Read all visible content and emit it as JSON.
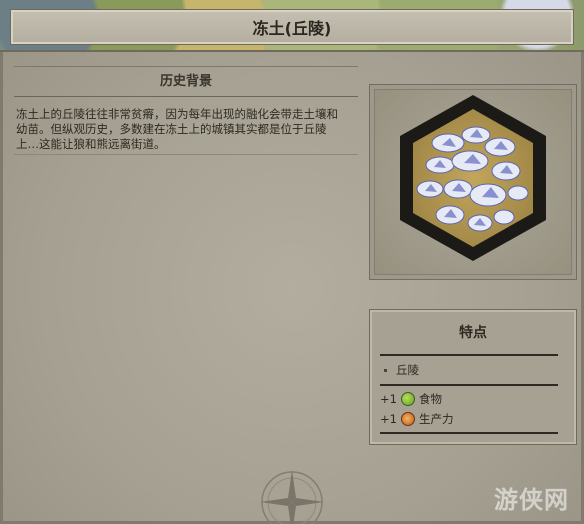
{
  "header": {
    "title": "冻土(丘陵)"
  },
  "history": {
    "title": "历史背景",
    "text": "冻土上的丘陵往往非常贫瘠，因为每年出现的融化会带走土壤和幼苗。但纵观历史，多数建在冻土上的城镇其实都是位于丘陵上…这能让狼和熊远离街道。"
  },
  "features": {
    "title": "特点",
    "terrain_item": "丘陵",
    "yields": [
      {
        "amount": "+1",
        "label": "食物",
        "icon": "food-icon"
      },
      {
        "amount": "+1",
        "label": "生产力",
        "icon": "production-icon"
      }
    ]
  },
  "watermark": "游侠网",
  "colors": {
    "panel_bg": "#a8a395",
    "border": "#6f6a5c",
    "tile_hex_border": "#1c1a17",
    "tile_ground": "#b89f55",
    "tile_snow": "#e4e8f4",
    "tile_shadow": "#5b63b5"
  }
}
